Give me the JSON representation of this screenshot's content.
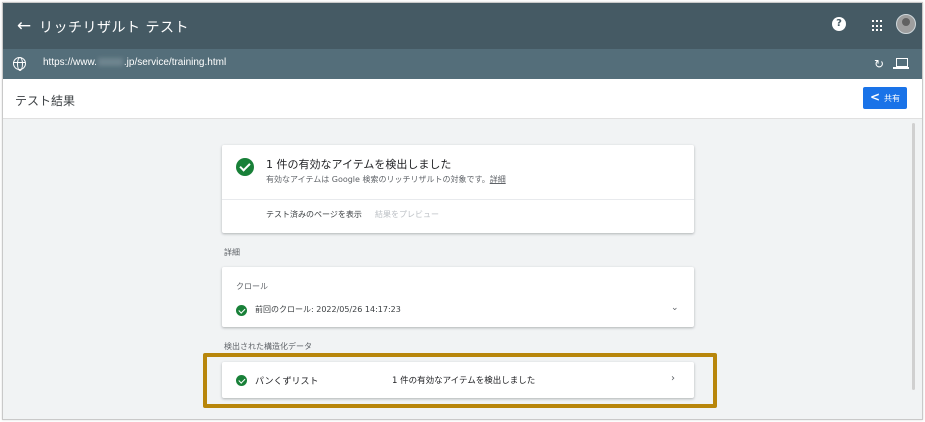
{
  "appbar": {
    "title": "リッチリザルト テスト"
  },
  "urlbar": {
    "url_prefix": "https://www.",
    "url_suffix": ".jp/service/training.html"
  },
  "titlebar": {
    "title": "テスト結果",
    "share_label": "共有"
  },
  "summary": {
    "title": "1 件の有効なアイテムを検出しました",
    "description": "有効なアイテムは Google 検索のリッチリザルトの対象です。",
    "details_link": "詳細",
    "tested_page_label": "テスト済みのページを表示",
    "preview_label": "結果をプレビュー"
  },
  "details": {
    "section_label": "詳細",
    "crawl_label": "クロール",
    "last_crawl": "前回のクロール: 2022/05/26 14:17:23"
  },
  "structured_data": {
    "section_label": "検出された構造化データ",
    "items": [
      {
        "name": "パンくずリスト",
        "status": "1 件の有効なアイテムを検出しました"
      }
    ]
  },
  "colors": {
    "appbar": "#455a64",
    "urlbar": "#546e7a",
    "success": "#188038",
    "primary": "#1a73e8",
    "highlight": "#b8860b"
  },
  "icons": {
    "back": "arrow-back-icon",
    "help": "help-icon",
    "apps": "apps-grid-icon",
    "globe": "globe-icon",
    "reload": "reload-icon",
    "device": "laptop-icon",
    "share": "share-icon",
    "valid": "check-circle-icon"
  }
}
